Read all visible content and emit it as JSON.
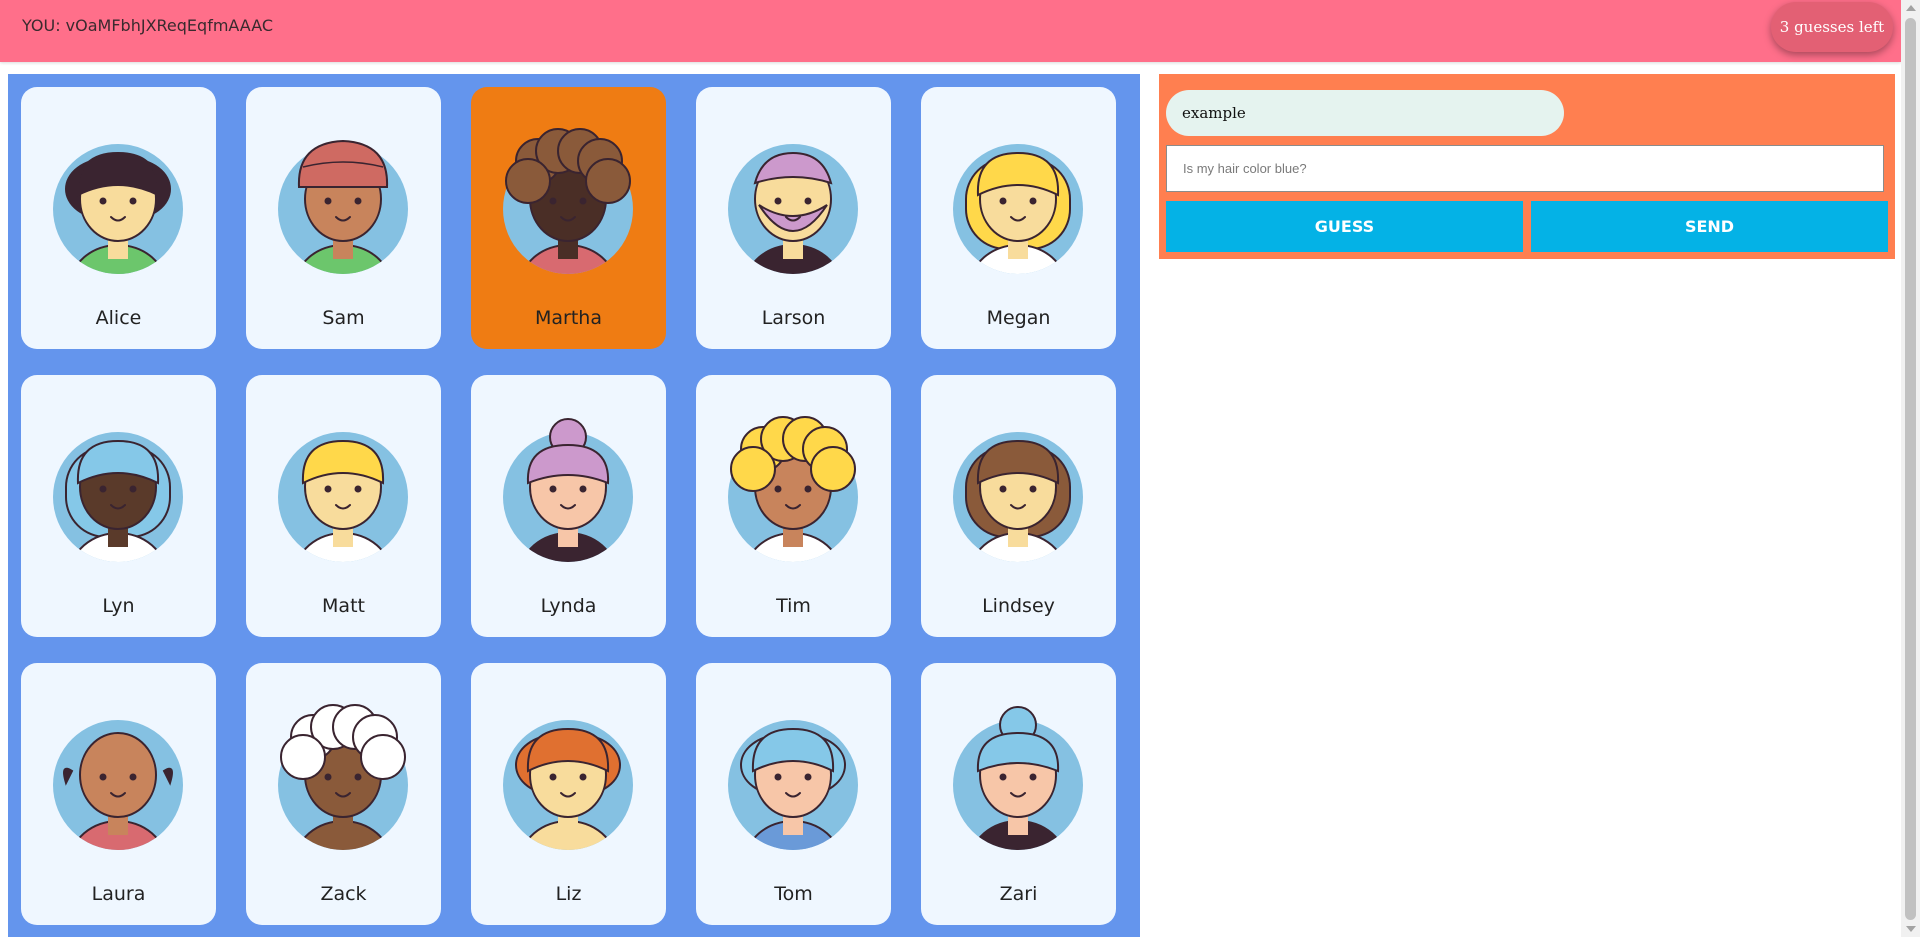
{
  "header": {
    "you_label": "YOU: vOaMFbhJXReqEqfmAAAC",
    "guesses_left": "3 guesses left"
  },
  "board": {
    "characters": [
      {
        "name": "Alice",
        "skin": "#f8dc9c",
        "hair": "#3a2430",
        "hair_style": "bob",
        "shirt": "#6cc66c",
        "selected": false
      },
      {
        "name": "Sam",
        "skin": "#c8845c",
        "hair": "#cf6a62",
        "hair_style": "turban",
        "shirt": "#6cc66c",
        "selected": false
      },
      {
        "name": "Martha",
        "skin": "#4a2e26",
        "hair": "#8a5a3a",
        "hair_style": "afro",
        "shirt": "#d86a70",
        "selected": true
      },
      {
        "name": "Larson",
        "skin": "#f8dc9c",
        "hair": "#cc99cc",
        "hair_style": "beard",
        "shirt": "#3a2430",
        "selected": false
      },
      {
        "name": "Megan",
        "skin": "#f8dc9c",
        "hair": "#ffd84a",
        "hair_style": "long",
        "shirt": "#ffffff",
        "selected": false
      },
      {
        "name": "Lyn",
        "skin": "#5a3a2a",
        "hair": "#85c8e8",
        "hair_style": "long",
        "shirt": "#ffffff",
        "selected": false
      },
      {
        "name": "Matt",
        "skin": "#f8dc9c",
        "hair": "#ffd84a",
        "hair_style": "short",
        "shirt": "#ffffff",
        "selected": false
      },
      {
        "name": "Lynda",
        "skin": "#f7c6a8",
        "hair": "#cc99cc",
        "hair_style": "bun",
        "shirt": "#3a2430",
        "selected": false
      },
      {
        "name": "Tim",
        "skin": "#c8845c",
        "hair": "#ffd84a",
        "hair_style": "afro",
        "shirt": "#ffffff",
        "selected": false
      },
      {
        "name": "Lindsey",
        "skin": "#f8dc9c",
        "hair": "#8a5a3a",
        "hair_style": "long",
        "shirt": "#ffffff",
        "selected": false
      },
      {
        "name": "Laura",
        "skin": "#c8845c",
        "hair": "#3a2430",
        "hair_style": "bald",
        "shirt": "#d86a70",
        "selected": false
      },
      {
        "name": "Zack",
        "skin": "#8a5a3a",
        "hair": "#ffffff",
        "hair_style": "afro",
        "shirt": "#8a5a3a",
        "selected": false
      },
      {
        "name": "Liz",
        "skin": "#f8dc9c",
        "hair": "#e07030",
        "hair_style": "bob",
        "shirt": "#f8dc9c",
        "selected": false
      },
      {
        "name": "Tom",
        "skin": "#f7c6a8",
        "hair": "#85c8e8",
        "hair_style": "bob",
        "shirt": "#6a9ad8",
        "selected": false
      },
      {
        "name": "Zari",
        "skin": "#f7c6a8",
        "hair": "#85c8e8",
        "hair_style": "bun",
        "shirt": "#3a2430",
        "selected": false
      }
    ]
  },
  "panel": {
    "name_value": "example",
    "question_placeholder": "Is my hair color blue?",
    "guess_label": "GUESS",
    "send_label": "SEND"
  },
  "colors": {
    "header_bg": "#ff6f8a",
    "board_bg": "#6495ed",
    "card_bg": "#eff7ff",
    "card_selected_bg": "#ef7c13",
    "panel_bg": "#ff7f50",
    "button_bg": "#04b2e6",
    "avatar_circle": "#85c1e2"
  }
}
